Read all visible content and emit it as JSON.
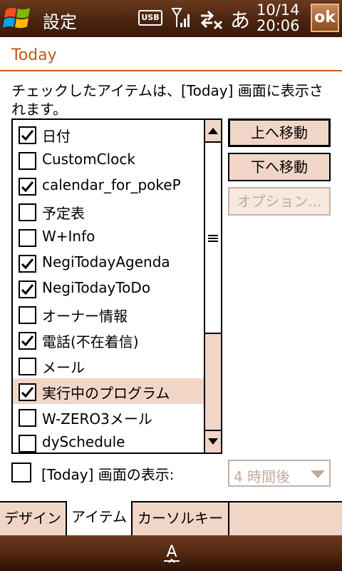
{
  "titlebar": {
    "title": "設定",
    "usb_label": "USB",
    "ime": "あ",
    "date": "10/14",
    "time": "20:06",
    "ok_label": "ok"
  },
  "header": {
    "title": "Today"
  },
  "instruction": "チェックしたアイテムは、[Today] 画面に表示されます。",
  "items": [
    {
      "label": "日付",
      "checked": true
    },
    {
      "label": "CustomClock",
      "checked": false
    },
    {
      "label": "calendar_for_pokeP",
      "checked": true
    },
    {
      "label": "予定表",
      "checked": false
    },
    {
      "label": "W+Info",
      "checked": false
    },
    {
      "label": "NegiTodayAgenda",
      "checked": true
    },
    {
      "label": "NegiTodayToDo",
      "checked": true
    },
    {
      "label": "オーナー情報",
      "checked": false
    },
    {
      "label": "電話(不在着信)",
      "checked": true
    },
    {
      "label": "メール",
      "checked": false
    },
    {
      "label": "実行中のプログラム",
      "checked": true,
      "selected": true
    },
    {
      "label": "W-ZERO3メール",
      "checked": false
    },
    {
      "label": "dySchedule",
      "checked": false
    }
  ],
  "buttons": {
    "move_up": "上へ移動",
    "move_down": "下へ移動",
    "options": "オプション..."
  },
  "show_today": {
    "label": "[Today] 画面の表示:",
    "checked": false,
    "hours_value": "4 時間後"
  },
  "tabs": [
    {
      "label": "デザイン",
      "active": false
    },
    {
      "label": "アイテム",
      "active": true
    },
    {
      "label": "カーソルキー",
      "active": false
    }
  ],
  "softbar": {
    "sip_label": "A"
  },
  "colors": {
    "accent": "#c35a1a",
    "bar_brown": "#4a2410",
    "selection": "#f1d6c8",
    "disabled": "#c0aaa0"
  }
}
